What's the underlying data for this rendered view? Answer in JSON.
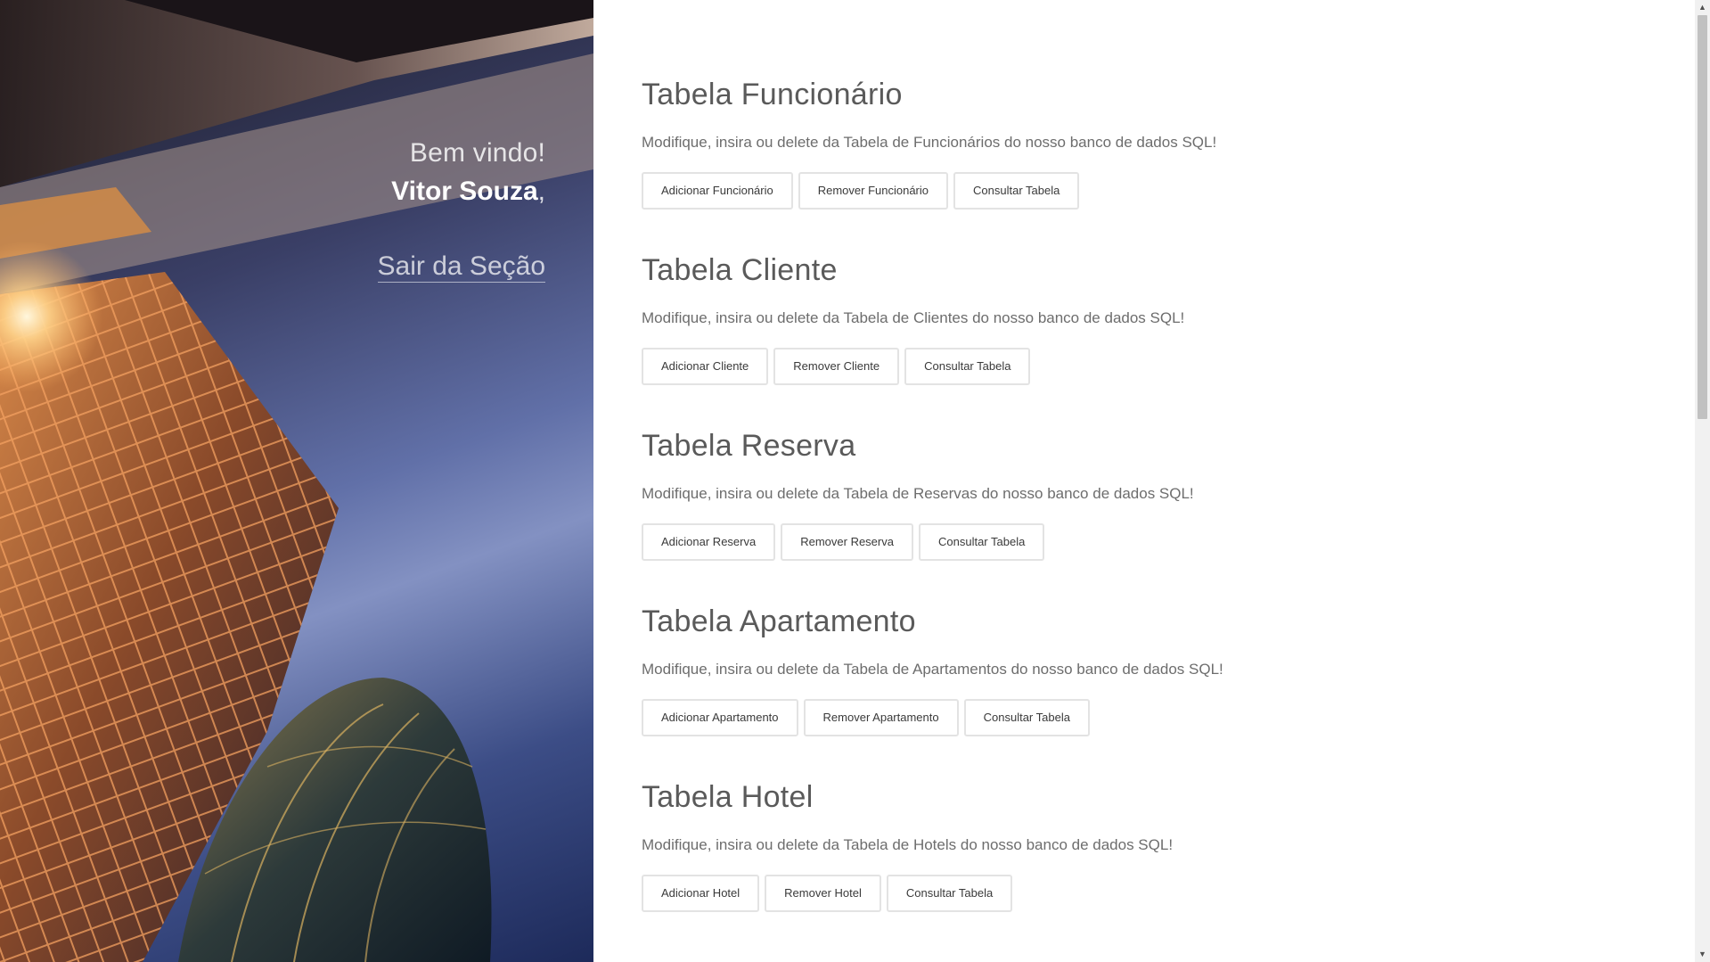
{
  "sidebar": {
    "welcome": "Bem vindo!",
    "user_name": "Vitor Souza",
    "name_suffix": ",",
    "logout_label": "Sair da Seção"
  },
  "sections": [
    {
      "title": "Tabela Funcionário",
      "description": "Modifique, insira ou delete da Tabela de Funcionários do nosso banco de dados SQL!",
      "buttons": [
        "Adicionar Funcionário",
        "Remover Funcionário",
        "Consultar Tabela"
      ]
    },
    {
      "title": "Tabela Cliente",
      "description": "Modifique, insira ou delete da Tabela de Clientes do nosso banco de dados SQL!",
      "buttons": [
        "Adicionar Cliente",
        "Remover Cliente",
        "Consultar Tabela"
      ]
    },
    {
      "title": "Tabela Reserva",
      "description": "Modifique, insira ou delete da Tabela de Reservas do nosso banco de dados SQL!",
      "buttons": [
        "Adicionar Reserva",
        "Remover Reserva",
        "Consultar Tabela"
      ]
    },
    {
      "title": "Tabela Apartamento",
      "description": "Modifique, insira ou delete da Tabela de Apartamentos do nosso banco de dados SQL!",
      "buttons": [
        "Adicionar Apartamento",
        "Remover Apartamento",
        "Consultar Tabela"
      ]
    },
    {
      "title": "Tabela Hotel",
      "description": "Modifique, insira ou delete da Tabela de Hotels do nosso banco de dados SQL!",
      "buttons": [
        "Adicionar Hotel",
        "Remover Hotel",
        "Consultar Tabela"
      ]
    }
  ],
  "scrollbar": {
    "up_icon": "triangle-up-icon",
    "down_icon": "triangle-down-icon"
  },
  "colors": {
    "heading": "#5a5a5a",
    "text": "#6d6d6d",
    "button_border": "#e3e3e3"
  }
}
